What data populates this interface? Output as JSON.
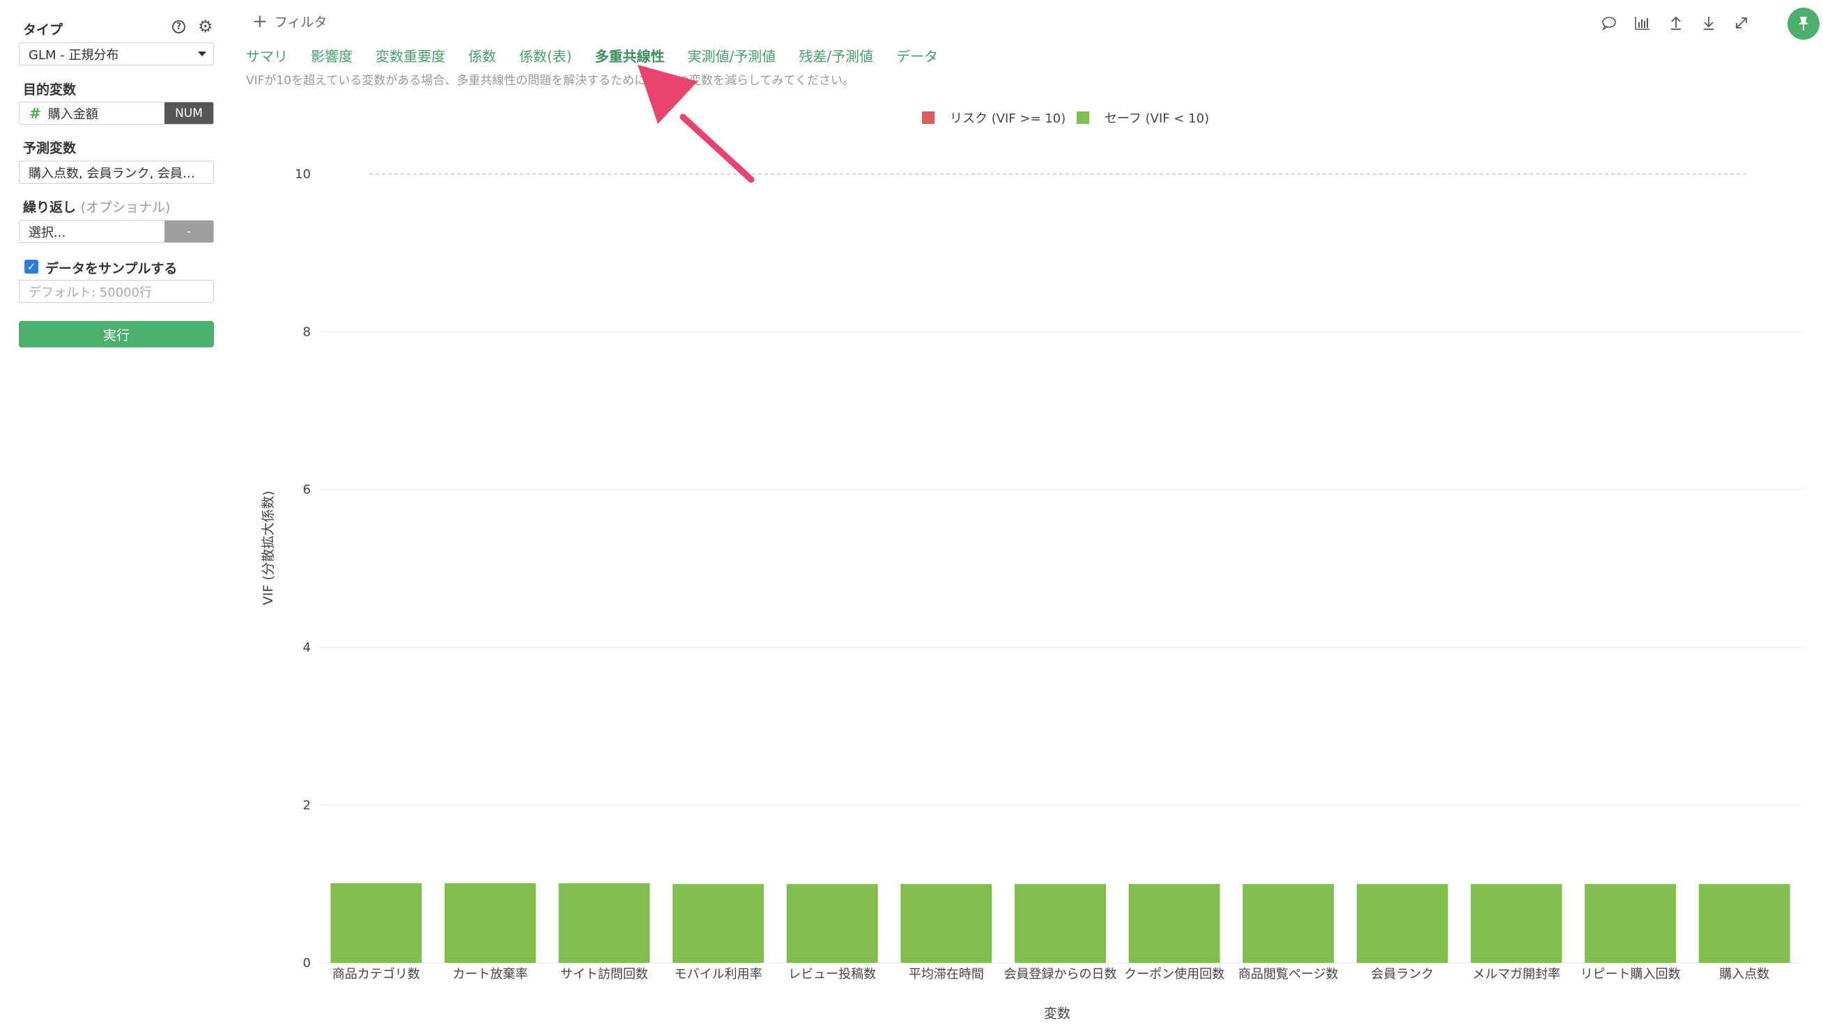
{
  "sidebar": {
    "type_label": "タイプ",
    "type_value": "GLM - 正規分布",
    "target_label": "目的変数",
    "target_value": "購入金額",
    "target_badge": "NUM",
    "predictor_label": "予測変数",
    "predictor_value": "購入点数, 会員ランク, 会員…",
    "repeat_label": "繰り返し",
    "repeat_optional": "(オプショナル)",
    "repeat_value": "選択...",
    "repeat_button": "-",
    "sample_label": "データをサンプルする",
    "sample_checked": true,
    "sample_placeholder": "デフォルト: 50000行",
    "run_label": "実行"
  },
  "header": {
    "filter_label": "フィルタ",
    "tabs": [
      {
        "label": "サマリ",
        "active": false
      },
      {
        "label": "影響度",
        "active": false
      },
      {
        "label": "変数重要度",
        "active": false
      },
      {
        "label": "係数",
        "active": false
      },
      {
        "label": "係数(表)",
        "active": false
      },
      {
        "label": "多重共線性",
        "active": true
      },
      {
        "label": "実測値/予測値",
        "active": false
      },
      {
        "label": "残差/予測値",
        "active": false
      },
      {
        "label": "データ",
        "active": false
      }
    ],
    "description": "VIFが10を超えている変数がある場合、多重共線性の問題を解決するために1つずつ変数を減らしてみてください。"
  },
  "toolbar": {
    "icons": [
      "comment-icon",
      "bar-chart-icon",
      "upload-icon",
      "download-icon",
      "expand-icon",
      "pin-icon"
    ]
  },
  "colors": {
    "accent": "#4caf6e",
    "risk": "#e05c5c",
    "safe": "#82bd50",
    "arrow": "#e8436f"
  },
  "chart_data": {
    "type": "bar",
    "title": "",
    "xlabel": "変数",
    "ylabel": "VIF (分散拡大係数)",
    "ylim": [
      0,
      10
    ],
    "yticks": [
      0,
      2,
      4,
      6,
      8,
      10
    ],
    "threshold": 10,
    "legend": [
      {
        "name": "リスク (VIF >= 10)",
        "color": "#e05c5c"
      },
      {
        "name": "セーフ (VIF < 10)",
        "color": "#82bd50"
      }
    ],
    "legend_position": "top-center",
    "categories": [
      "商品カテゴリ数",
      "カート放棄率",
      "サイト訪問回数",
      "モバイル利用率",
      "レビュー投稿数",
      "平均滞在時間",
      "会員登録からの日数",
      "クーポン使用回数",
      "商品閲覧ページ数",
      "会員ランク",
      "メルマガ開封率",
      "リピート購入回数",
      "購入点数"
    ],
    "values": [
      1.01,
      1.01,
      1.01,
      1.0,
      1.0,
      1.0,
      1.0,
      1.0,
      1.0,
      1.0,
      1.0,
      1.0,
      1.0
    ],
    "grid": true
  }
}
